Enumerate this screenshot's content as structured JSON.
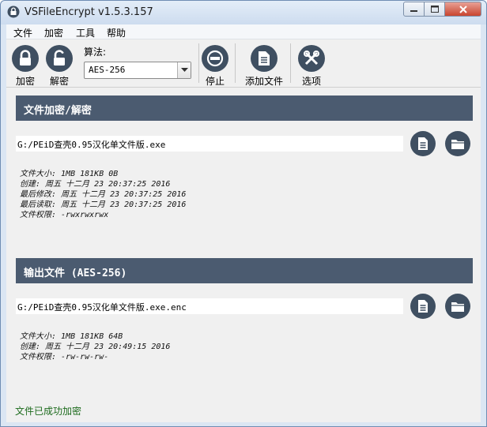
{
  "window": {
    "title": "VSFileEncrypt v1.5.3.157"
  },
  "menu": [
    "文件",
    "加密",
    "工具",
    "帮助"
  ],
  "toolbar": {
    "encrypt_label": "加密",
    "decrypt_label": "解密",
    "algorithm_label": "算法:",
    "algorithm_value": "AES-256",
    "stop_label": "停止",
    "add_file_label": "添加文件",
    "options_label": "选项"
  },
  "source": {
    "header": "文件加密/解密",
    "path": "G:/PEiD查壳0.95汉化单文件版.exe",
    "info": [
      "文件大小: 1MB 181KB 0B",
      "创建: 周五 十二月 23 20:37:25 2016",
      "最后修改: 周五 十二月 23 20:37:25 2016",
      "最后读取: 周五 十二月 23 20:37:25 2016",
      "文件权限: -rwxrwxrwx"
    ]
  },
  "output": {
    "header": "输出文件 (AES-256)",
    "path": "G:/PEiD查壳0.95汉化单文件版.exe.enc",
    "info": [
      "文件大小: 1MB 181KB 64B",
      "创建: 周五 十二月 23 20:49:15 2016",
      "文件权限: -rw-rw-rw-"
    ]
  },
  "status": "文件已成功加密",
  "colors": {
    "accent": "#4b5b70",
    "icon_bg": "#3f4f61",
    "status_text": "#1d6b1d"
  }
}
